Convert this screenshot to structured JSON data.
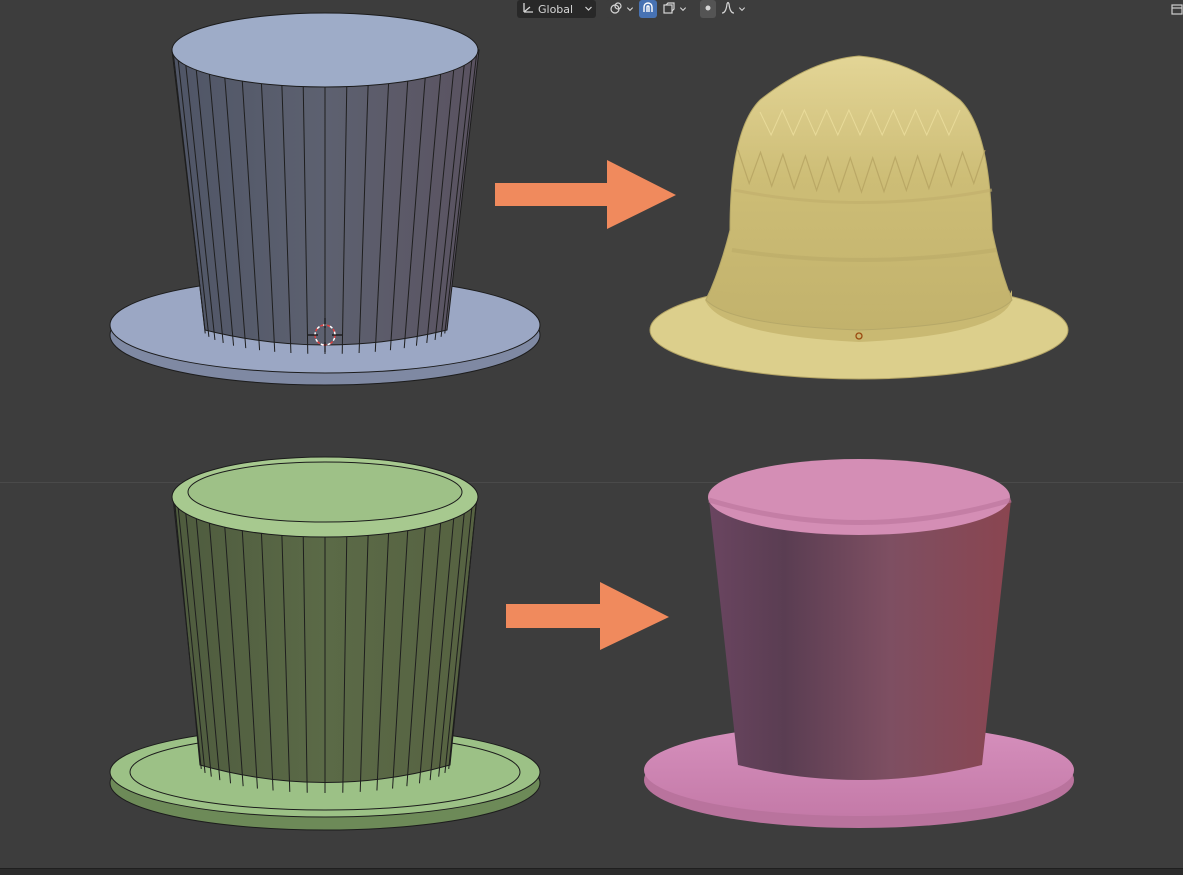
{
  "toolbar": {
    "transform_orientation": "Global",
    "orientation_icon": "transform-orientation-icon",
    "pivot_icon": "pivot-point-icon",
    "snap_icon": "snap-magnet-icon",
    "snap_target_icon": "snap-target-icon",
    "proportional_icon": "proportional-editing-icon",
    "falloff_icon": "falloff-curve-icon"
  },
  "colors": {
    "background": "#3d3d3d",
    "arrow": "#f08a5d",
    "blue_hat": "#8e9bb5",
    "yellow_hat": "#d6c98a",
    "green_hat": "#8fb876",
    "pink_hat": "#d48fb4"
  }
}
